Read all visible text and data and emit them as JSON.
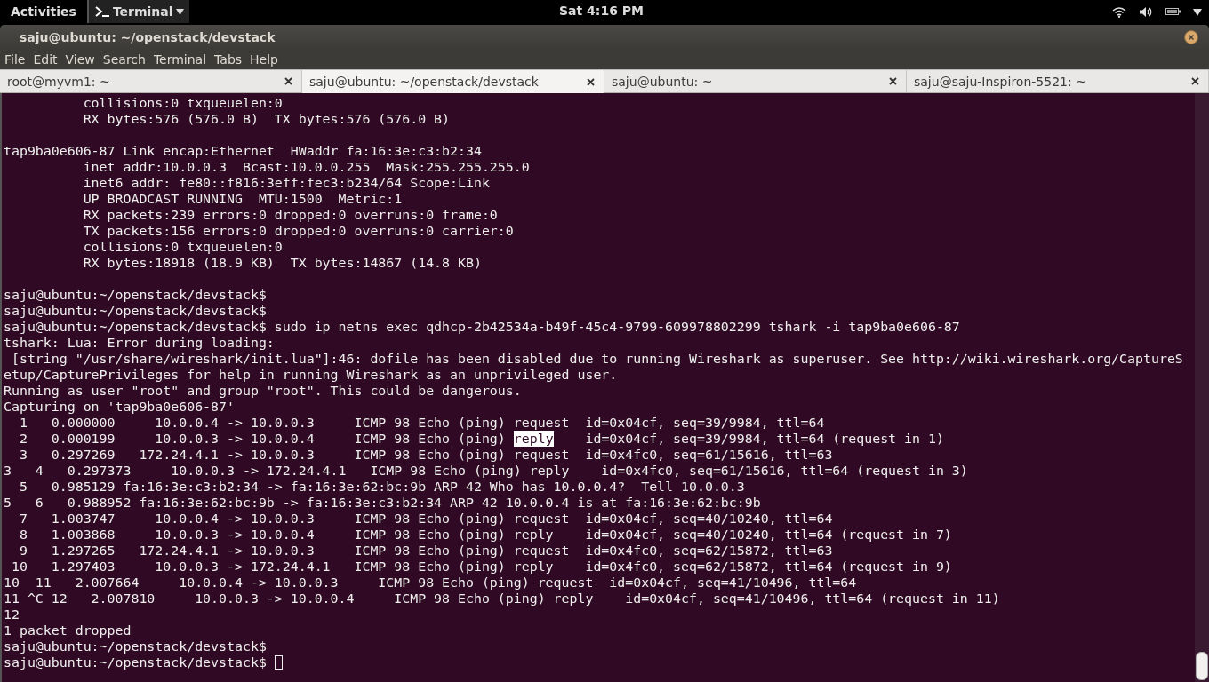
{
  "top_bar": {
    "activities": "Activities",
    "app_menu": "Terminal",
    "clock": "Sat  4:16 PM"
  },
  "window": {
    "title": "saju@ubuntu: ~/openstack/devstack"
  },
  "menu": [
    "File",
    "Edit",
    "View",
    "Search",
    "Terminal",
    "Tabs",
    "Help"
  ],
  "tabs": [
    {
      "label": "root@myvm1: ~",
      "selected": false
    },
    {
      "label": "saju@ubuntu: ~/openstack/devstack",
      "selected": true
    },
    {
      "label": "saju@ubuntu: ~",
      "selected": false
    },
    {
      "label": "saju@saju-Inspiron-5521: ~",
      "selected": false
    }
  ],
  "terminal": {
    "lines": [
      {
        "kind": "text",
        "text": "          collisions:0 txqueuelen:0"
      },
      {
        "kind": "text",
        "text": "          RX bytes:576 (576.0 B)  TX bytes:576 (576.0 B)"
      },
      {
        "kind": "blank"
      },
      {
        "kind": "text",
        "text": "tap9ba0e606-87 Link encap:Ethernet  HWaddr fa:16:3e:c3:b2:34"
      },
      {
        "kind": "text",
        "text": "          inet addr:10.0.0.3  Bcast:10.0.0.255  Mask:255.255.255.0"
      },
      {
        "kind": "text",
        "text": "          inet6 addr: fe80::f816:3eff:fec3:b234/64 Scope:Link"
      },
      {
        "kind": "text",
        "text": "          UP BROADCAST RUNNING  MTU:1500  Metric:1"
      },
      {
        "kind": "text",
        "text": "          RX packets:239 errors:0 dropped:0 overruns:0 frame:0"
      },
      {
        "kind": "text",
        "text": "          TX packets:156 errors:0 dropped:0 overruns:0 carrier:0"
      },
      {
        "kind": "text",
        "text": "          collisions:0 txqueuelen:0"
      },
      {
        "kind": "text",
        "text": "          RX bytes:18918 (18.9 KB)  TX bytes:14867 (14.8 KB)"
      },
      {
        "kind": "blank"
      },
      {
        "kind": "text",
        "text": "saju@ubuntu:~/openstack/devstack$"
      },
      {
        "kind": "text",
        "text": "saju@ubuntu:~/openstack/devstack$"
      },
      {
        "kind": "text",
        "text": "saju@ubuntu:~/openstack/devstack$ sudo ip netns exec qdhcp-2b42534a-b49f-45c4-9799-609978802299 tshark -i tap9ba0e606-87"
      },
      {
        "kind": "text",
        "text": "tshark: Lua: Error during loading:"
      },
      {
        "kind": "text",
        "text": " [string \"/usr/share/wireshark/init.lua\"]:46: dofile has been disabled due to running Wireshark as superuser. See http://wiki.wireshark.org/CaptureS"
      },
      {
        "kind": "text",
        "text": "etup/CapturePrivileges for help in running Wireshark as an unprivileged user."
      },
      {
        "kind": "text",
        "text": "Running as user \"root\" and group \"root\". This could be dangerous."
      },
      {
        "kind": "text",
        "text": "Capturing on 'tap9ba0e606-87'"
      },
      {
        "kind": "text",
        "text": "  1   0.000000     10.0.0.4 -> 10.0.0.3     ICMP 98 Echo (ping) request  id=0x04cf, seq=39/9984, ttl=64"
      },
      {
        "kind": "segments",
        "segments": [
          {
            "text": "  2   0.000199     10.0.0.3 -> 10.0.0.4     ICMP 98 Echo (ping) ",
            "selected": false
          },
          {
            "text": "reply",
            "selected": true
          },
          {
            "text": "    id=0x04cf, seq=39/9984, ttl=64 (request in 1)",
            "selected": false
          }
        ]
      },
      {
        "kind": "text",
        "text": "  3   0.297269   172.24.4.1 -> 10.0.0.3     ICMP 98 Echo (ping) request  id=0x4fc0, seq=61/15616, ttl=63"
      },
      {
        "kind": "text",
        "text": "3   4   0.297373     10.0.0.3 -> 172.24.4.1   ICMP 98 Echo (ping) reply    id=0x4fc0, seq=61/15616, ttl=64 (request in 3)"
      },
      {
        "kind": "text",
        "text": "  5   0.985129 fa:16:3e:c3:b2:34 -> fa:16:3e:62:bc:9b ARP 42 Who has 10.0.0.4?  Tell 10.0.0.3"
      },
      {
        "kind": "text",
        "text": "5   6   0.988952 fa:16:3e:62:bc:9b -> fa:16:3e:c3:b2:34 ARP 42 10.0.0.4 is at fa:16:3e:62:bc:9b"
      },
      {
        "kind": "text",
        "text": "  7   1.003747     10.0.0.4 -> 10.0.0.3     ICMP 98 Echo (ping) request  id=0x04cf, seq=40/10240, ttl=64"
      },
      {
        "kind": "text",
        "text": "  8   1.003868     10.0.0.3 -> 10.0.0.4     ICMP 98 Echo (ping) reply    id=0x04cf, seq=40/10240, ttl=64 (request in 7)"
      },
      {
        "kind": "text",
        "text": "  9   1.297265   172.24.4.1 -> 10.0.0.3     ICMP 98 Echo (ping) request  id=0x4fc0, seq=62/15872, ttl=63"
      },
      {
        "kind": "text",
        "text": " 10   1.297403     10.0.0.3 -> 172.24.4.1   ICMP 98 Echo (ping) reply    id=0x4fc0, seq=62/15872, ttl=64 (request in 9)"
      },
      {
        "kind": "text",
        "text": "10  11   2.007664     10.0.0.4 -> 10.0.0.3     ICMP 98 Echo (ping) request  id=0x04cf, seq=41/10496, ttl=64"
      },
      {
        "kind": "text",
        "text": "11 ^C 12   2.007810     10.0.0.3 -> 10.0.0.4     ICMP 98 Echo (ping) reply    id=0x04cf, seq=41/10496, ttl=64 (request in 11)"
      },
      {
        "kind": "text",
        "text": "12"
      },
      {
        "kind": "text",
        "text": "1 packet dropped"
      },
      {
        "kind": "text",
        "text": "saju@ubuntu:~/openstack/devstack$"
      },
      {
        "kind": "prompt",
        "text": "saju@ubuntu:~/openstack/devstack$ "
      }
    ]
  }
}
